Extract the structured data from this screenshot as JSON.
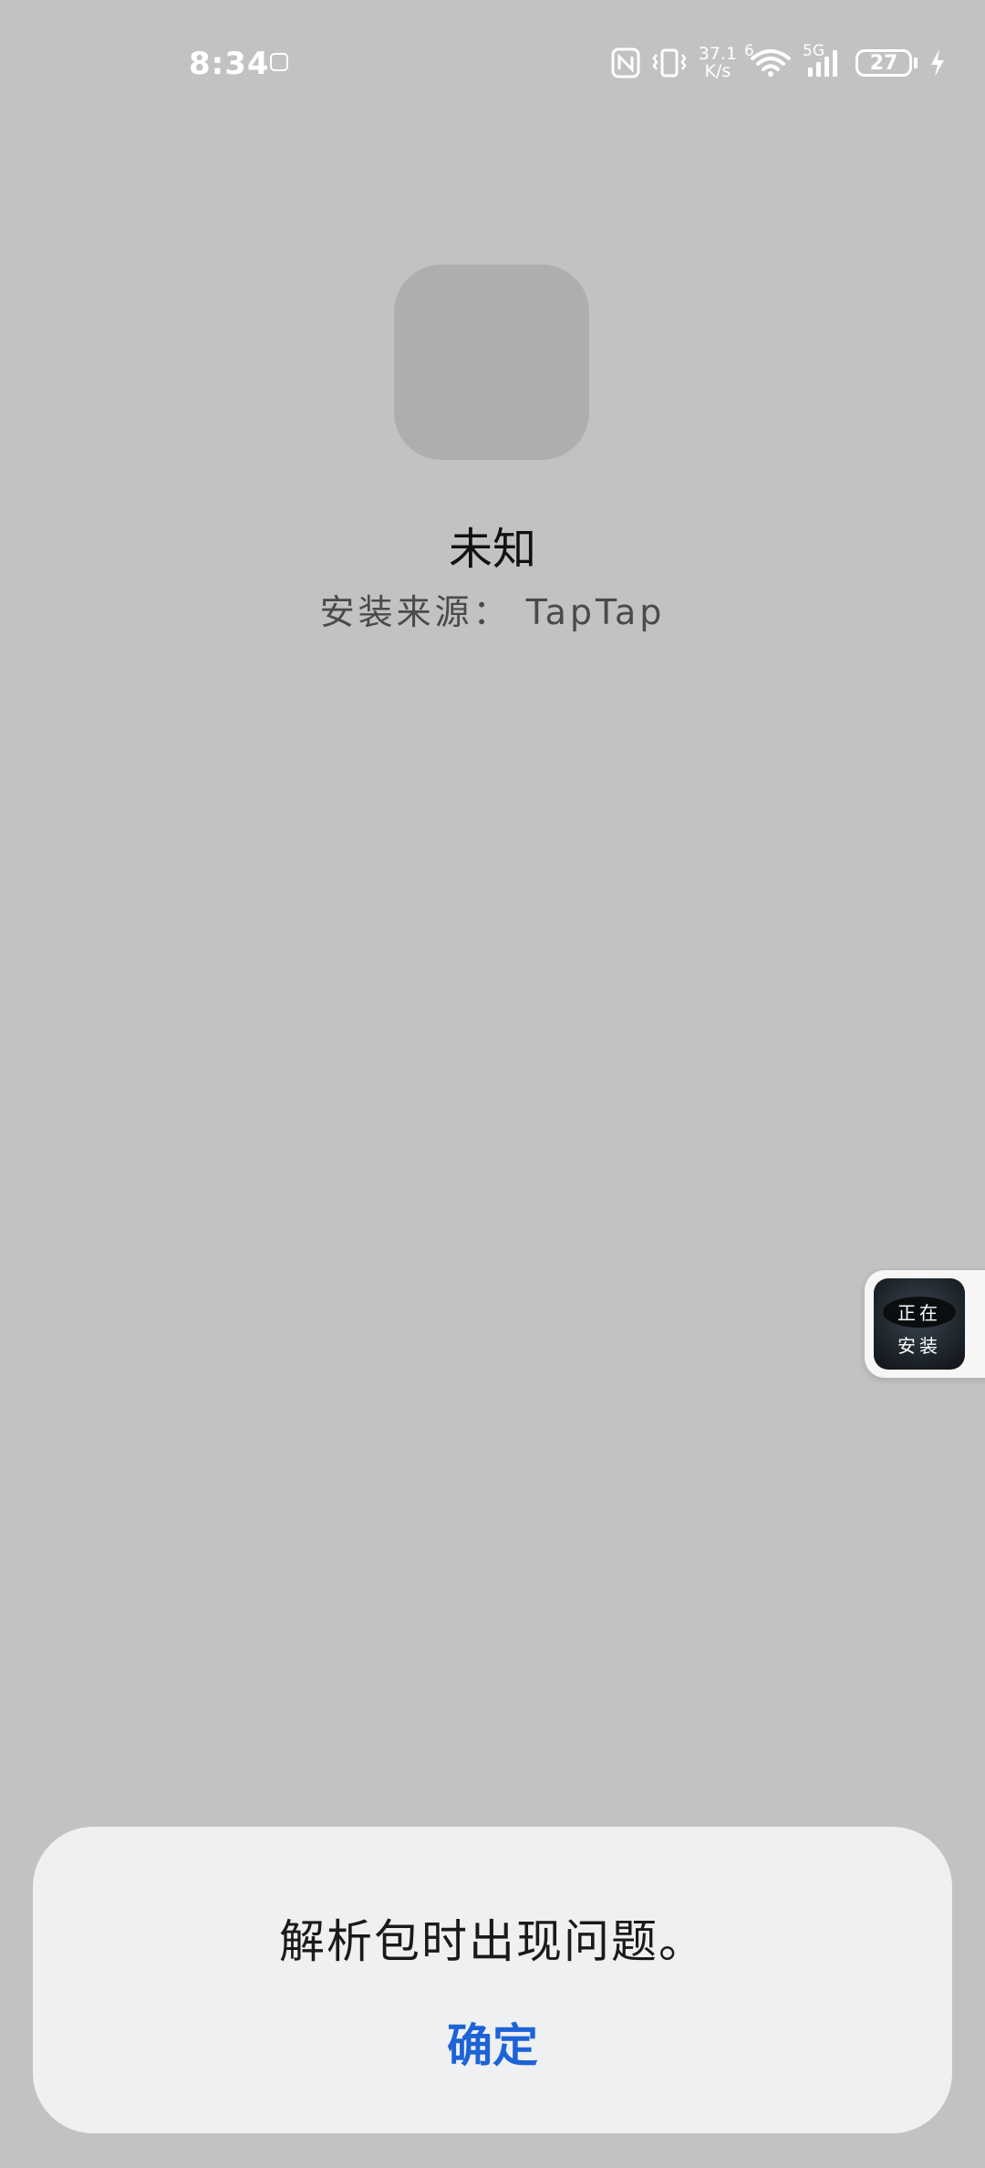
{
  "status_bar": {
    "time": "8:34",
    "net_speed_value": "37.1",
    "net_speed_unit": "K/s",
    "wifi_sub": "6",
    "cell_label": "5G",
    "battery_level": "27"
  },
  "app": {
    "name": "未知",
    "install_source": "安装来源： TapTap"
  },
  "floating_widget": {
    "label": "正在\n安装"
  },
  "dialog": {
    "message": "解析包时出现问题。",
    "confirm_label": "确定"
  },
  "colors": {
    "background": "#c1c2c4",
    "dialog_background": "#eff0f1",
    "accent": "#1d63d6"
  }
}
